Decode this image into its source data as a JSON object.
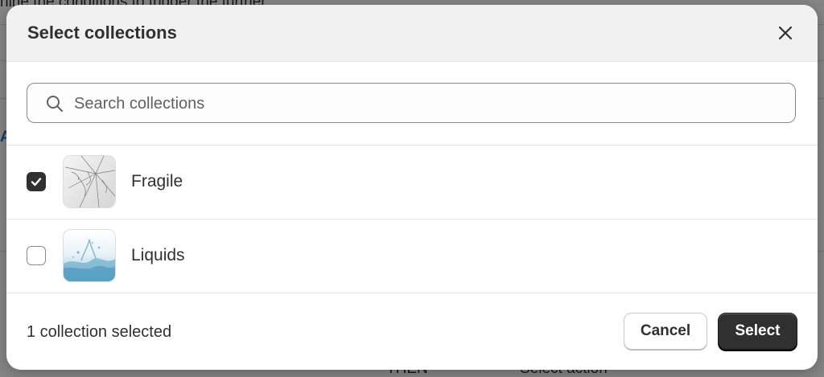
{
  "modal": {
    "title": "Select collections",
    "close_icon": "close-icon"
  },
  "search": {
    "placeholder": "Search collections",
    "value": "",
    "icon": "search-icon"
  },
  "collections": [
    {
      "label": "Fragile",
      "checked": true,
      "thumbnail": "cracked-glass-image"
    },
    {
      "label": "Liquids",
      "checked": false,
      "thumbnail": "water-splash-image"
    }
  ],
  "footer": {
    "status": "1 collection selected",
    "cancel_label": "Cancel",
    "select_label": "Select"
  },
  "colors": {
    "primary_button": "#303030",
    "checkbox_checked": "#303030",
    "header_bg": "#f1f1f1"
  }
}
